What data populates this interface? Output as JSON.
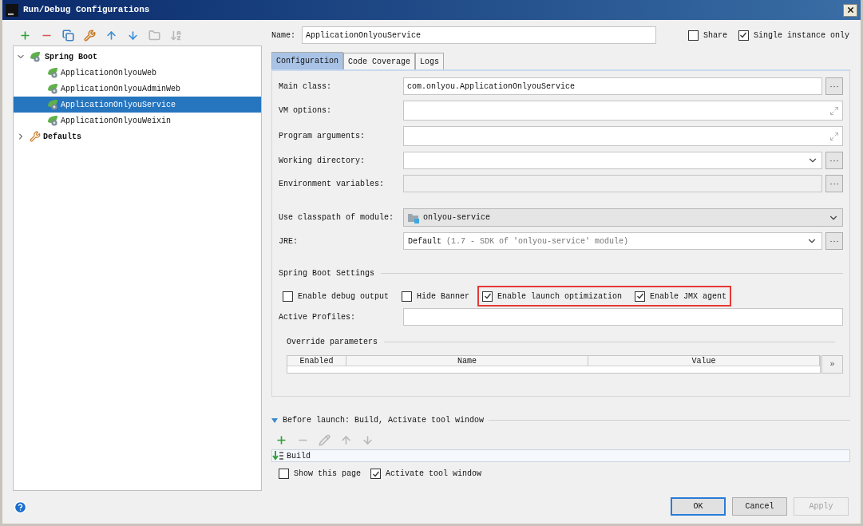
{
  "window": {
    "title": "Run/Debug Configurations"
  },
  "toolbar": [
    {
      "kind": "add",
      "disabled": false
    },
    {
      "kind": "remove",
      "disabled": false
    },
    {
      "kind": "copy",
      "disabled": false
    },
    {
      "kind": "edit-defaults",
      "disabled": false
    },
    {
      "kind": "up",
      "disabled": false
    },
    {
      "kind": "down",
      "disabled": false
    },
    {
      "kind": "folder",
      "disabled": true
    },
    {
      "kind": "sort",
      "disabled": true
    }
  ],
  "tree": [
    {
      "label": "Spring Boot",
      "kind": "spring",
      "expanded": true,
      "selected": false,
      "children": [
        {
          "label": "ApplicationOnlyouWeb",
          "selected": false
        },
        {
          "label": "ApplicationOnlyouAdminWeb",
          "selected": false
        },
        {
          "label": "ApplicationOnlyouService",
          "selected": true
        },
        {
          "label": "ApplicationOnlyouWeixin",
          "selected": false
        }
      ]
    },
    {
      "label": "Defaults",
      "kind": "defaults",
      "expanded": false,
      "selected": false
    }
  ],
  "name_field": {
    "label": "Name:",
    "value": "ApplicationOnlyouService"
  },
  "header_options": [
    {
      "label": "Share",
      "checked": false
    },
    {
      "label": "Single instance only",
      "checked": true
    }
  ],
  "tabs": [
    {
      "label": "Configuration",
      "selected": true
    },
    {
      "label": "Code Coverage",
      "selected": false
    },
    {
      "label": "Logs",
      "selected": false
    }
  ],
  "fields": [
    {
      "label": "Main class:",
      "kind": "browse",
      "value": "com.onlyou.ApplicationOnlyouService"
    },
    {
      "label": "VM options:",
      "kind": "expand"
    },
    {
      "label": "Program arguments:",
      "kind": "expand"
    },
    {
      "label": "Working directory:",
      "kind": "combo-browse"
    },
    {
      "label": "Environment variables:",
      "kind": "disabled-browse"
    },
    {
      "label": "Use classpath of module:",
      "kind": "module",
      "value": "onlyou-service"
    },
    {
      "label": "JRE:",
      "kind": "jre",
      "value": "Default",
      "hint": "(1.7 - SDK of 'onlyou-service' module)"
    }
  ],
  "spring_boot_settings": {
    "title": "Spring Boot Settings",
    "options": [
      {
        "label": "Enable debug output",
        "checked": false,
        "highlighted": false
      },
      {
        "label": "Hide Banner",
        "checked": false,
        "highlighted": false
      },
      {
        "label": "Enable launch optimization",
        "checked": true,
        "highlighted": true
      },
      {
        "label": "Enable JMX agent",
        "checked": true,
        "highlighted": true
      }
    ],
    "active_profiles": {
      "label": "Active Profiles:"
    }
  },
  "override_parameters": {
    "title": "Override parameters",
    "columns": [
      "Enabled",
      "Name",
      "Value"
    ],
    "more_button": "»"
  },
  "before_launch": {
    "title": "Before launch: Build, Activate tool window",
    "expanded": true,
    "toolbar": [
      {
        "kind": "add",
        "disabled": false
      },
      {
        "kind": "remove",
        "disabled": true
      },
      {
        "kind": "edit",
        "disabled": true
      },
      {
        "kind": "up",
        "disabled": true
      },
      {
        "kind": "down",
        "disabled": true
      }
    ],
    "tasks": [
      {
        "label": "Build"
      }
    ],
    "options": [
      {
        "label": "Show this page",
        "checked": false
      },
      {
        "label": "Activate tool window",
        "checked": true
      }
    ]
  },
  "buttons": [
    {
      "label": "OK",
      "default": true,
      "disabled": false
    },
    {
      "label": "Cancel",
      "default": false,
      "disabled": false
    },
    {
      "label": "Apply",
      "default": false,
      "disabled": true
    }
  ]
}
